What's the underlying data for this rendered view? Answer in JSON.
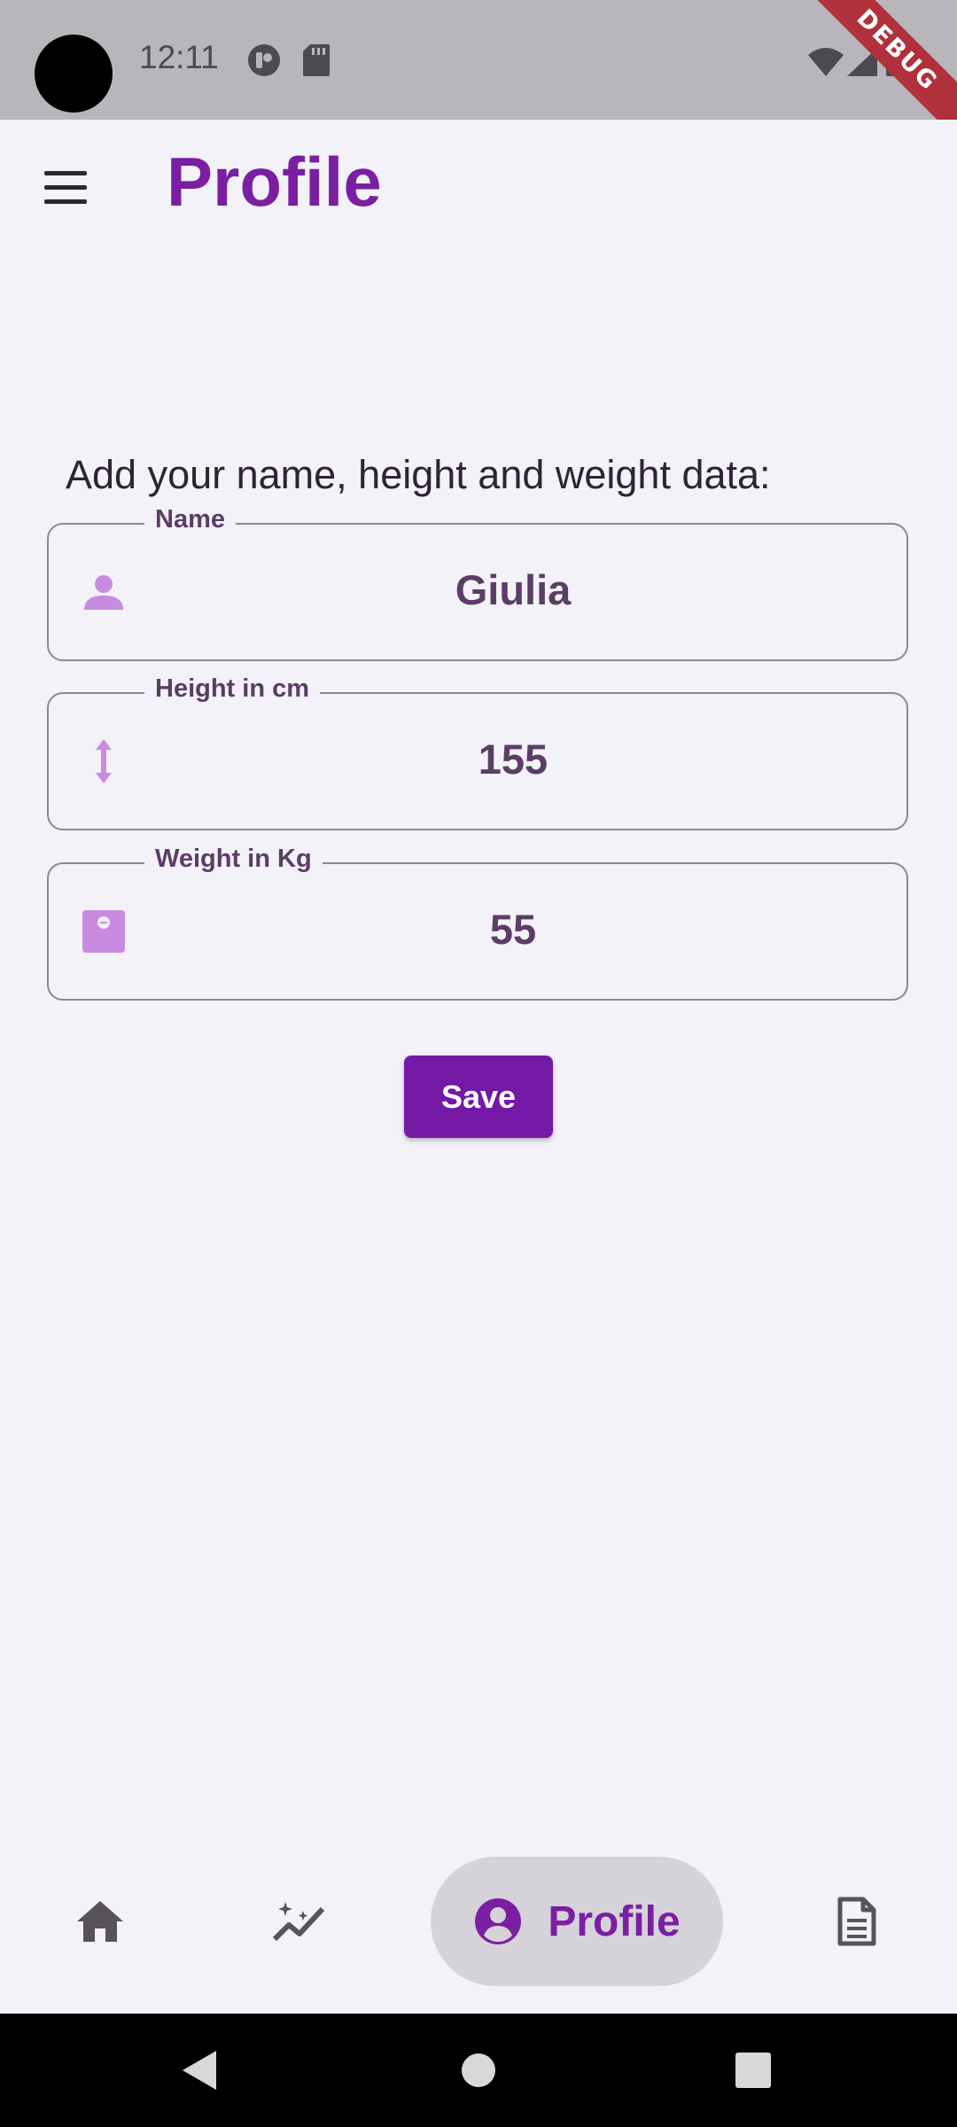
{
  "status_bar": {
    "time": "12:11",
    "debug_label": "DEBUG"
  },
  "app_bar": {
    "title": "Profile"
  },
  "form": {
    "instruction": "Add your name, height and weight data:",
    "fields": [
      {
        "label": "Name",
        "value": "Giulia",
        "icon": "person-icon"
      },
      {
        "label": "Height in cm",
        "value": "155",
        "icon": "height-arrows-icon"
      },
      {
        "label": "Weight in Kg",
        "value": "55",
        "icon": "scale-icon"
      }
    ],
    "save_label": "Save"
  },
  "bottom_nav": {
    "items": [
      {
        "icon": "home-icon"
      },
      {
        "icon": "insights-icon"
      },
      {
        "icon": "account-circle-icon",
        "label": "Profile",
        "active": true
      },
      {
        "icon": "document-icon"
      }
    ]
  },
  "colors": {
    "accent": "#7a1fa2",
    "button": "#7418a6",
    "icon": "#c98be0",
    "background": "#f2f2f8"
  }
}
